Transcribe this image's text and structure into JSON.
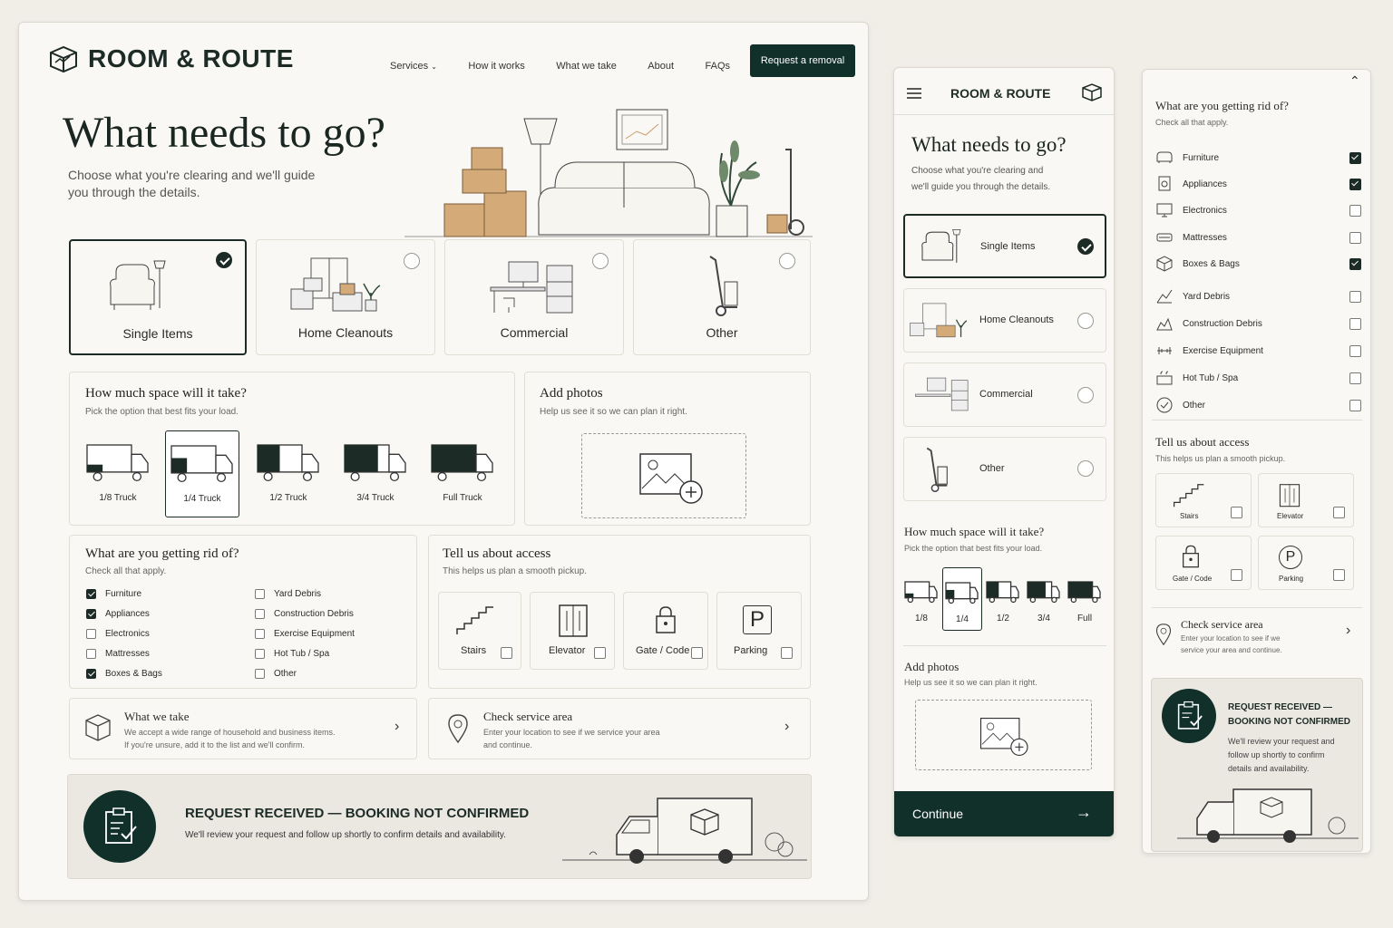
{
  "brand": {
    "name": "ROOM & ROUTE"
  },
  "nav": {
    "services": "Services",
    "how": "How it works",
    "take": "What we take",
    "about": "About",
    "faqs": "FAQs",
    "cta": "Request a removal"
  },
  "hero": {
    "title": "What needs to go?",
    "subtitle_1": "Choose what you're clearing and we'll guide",
    "subtitle_2": "you through the details."
  },
  "types": [
    {
      "label": "Single Items",
      "selected": true
    },
    {
      "label": "Home Cleanouts",
      "selected": false
    },
    {
      "label": "Commercial",
      "selected": false
    },
    {
      "label": "Other",
      "selected": false
    }
  ],
  "space": {
    "title": "How much space will it take?",
    "hint": "Pick the option that best fits your load.",
    "options": [
      "1/8 Truck",
      "1/4 Truck",
      "1/2 Truck",
      "3/4 Truck",
      "Full Truck"
    ],
    "selected": "1/4 Truck",
    "fill_fractions": [
      0.125,
      0.25,
      0.5,
      0.75,
      1.0
    ]
  },
  "photos": {
    "title": "Add photos",
    "hint": "Help us see it so we can plan it right."
  },
  "rid": {
    "title": "What are you getting rid of?",
    "hint": "Check all that apply.",
    "col1": [
      {
        "label": "Furniture",
        "checked": true
      },
      {
        "label": "Appliances",
        "checked": true
      },
      {
        "label": "Electronics",
        "checked": false
      },
      {
        "label": "Mattresses",
        "checked": false
      },
      {
        "label": "Boxes & Bags",
        "checked": true
      }
    ],
    "col2": [
      {
        "label": "Yard Debris",
        "checked": false
      },
      {
        "label": "Construction Debris",
        "checked": false
      },
      {
        "label": "Exercise Equipment",
        "checked": false
      },
      {
        "label": "Hot Tub / Spa",
        "checked": false
      },
      {
        "label": "Other",
        "checked": false
      }
    ]
  },
  "access": {
    "title": "Tell us about access",
    "hint": "This helps us plan a smooth pickup.",
    "options": [
      "Stairs",
      "Elevator",
      "Gate / Code",
      "Parking"
    ]
  },
  "take": {
    "title": "What we take",
    "line1": "We accept a wide range of household and business items.",
    "line2": "If you're unsure, add it to the list and we'll confirm."
  },
  "service": {
    "title": "Check service area",
    "line1": "Enter your location to see if we service your area",
    "line2": "and continue."
  },
  "banner": {
    "title": "REQUEST RECEIVED — BOOKING NOT CONFIRMED",
    "text": "We'll review your request and follow up shortly to confirm details and availability."
  },
  "mobile": {
    "brand": "ROOM & ROUTE",
    "title": "What needs to go?",
    "sub1": "Choose what you're clearing and",
    "sub2": "we'll guide you through the details.",
    "space_title": "How much space will it take?",
    "space_hint": "Pick the option that best fits your load.",
    "truck_labels": [
      "1/8",
      "1/4",
      "1/2",
      "3/4",
      "Full"
    ],
    "photos_title": "Add photos",
    "photos_hint": "Help us see it so we can plan it right.",
    "continue": "Continue"
  },
  "side": {
    "title": "What are you getting rid of?",
    "hint": "Check all that apply.",
    "items": [
      {
        "label": "Furniture",
        "checked": true
      },
      {
        "label": "Appliances",
        "checked": true
      },
      {
        "label": "Electronics",
        "checked": false
      },
      {
        "label": "Mattresses",
        "checked": false
      },
      {
        "label": "Boxes & Bags",
        "checked": true
      },
      {
        "label": "Yard Debris",
        "checked": false
      },
      {
        "label": "Construction Debris",
        "checked": false
      },
      {
        "label": "Exercise Equipment",
        "checked": false
      },
      {
        "label": "Hot Tub / Spa",
        "checked": false
      },
      {
        "label": "Other",
        "checked": false
      }
    ],
    "access_title": "Tell us about access",
    "access_hint": "This helps us plan a smooth pickup.",
    "access": [
      "Stairs",
      "Elevator",
      "Gate / Code",
      "Parking"
    ],
    "service_title": "Check service area",
    "service_l1": "Enter your location to see if we",
    "service_l2": "service your area and continue.",
    "banner_l1": "REQUEST RECEIVED —",
    "banner_l2": "BOOKING NOT CONFIRMED",
    "banner_t1": "We'll review your request and",
    "banner_t2": "follow up shortly to confirm",
    "banner_t3": "details and availability."
  },
  "colors": {
    "brand_green": "#12302a",
    "panel": "#faf8f4",
    "background": "#f1eee8",
    "box": "#d4aa78"
  }
}
